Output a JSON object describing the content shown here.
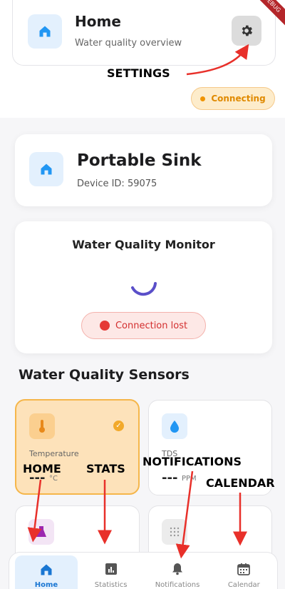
{
  "header": {
    "title": "Home",
    "subtitle": "Water quality overview",
    "debug_badge": "DEBUG"
  },
  "status": {
    "label": "Connecting"
  },
  "device": {
    "name": "Portable Sink",
    "id_text": "Device ID: 59075"
  },
  "monitor": {
    "title": "Water Quality Monitor",
    "connection_status": "Connection lost"
  },
  "sensors": {
    "section_title": "Water Quality Sensors",
    "items": [
      {
        "label": "Temperature",
        "value": "---",
        "unit": "°C",
        "icon": "thermometer-icon"
      },
      {
        "label": "TDS",
        "value": "---",
        "unit": "PPM",
        "icon": "water-drop-icon"
      },
      {
        "label": "",
        "value": "",
        "unit": "",
        "icon": "flask-icon"
      },
      {
        "label": "",
        "value": "",
        "unit": "",
        "icon": "grid-dots-icon"
      }
    ]
  },
  "nav": [
    {
      "label": "Home",
      "icon": "home-icon",
      "active": true
    },
    {
      "label": "Statistics",
      "icon": "bar-chart-icon",
      "active": false
    },
    {
      "label": "Notifications",
      "icon": "bell-icon",
      "active": false
    },
    {
      "label": "Calendar",
      "icon": "calendar-icon",
      "active": false
    }
  ],
  "annotations": {
    "settings": "SETTINGS",
    "home": "HOME",
    "stats": "STATS",
    "notifications": "NOTIFICATIONS",
    "calendar": "CALENDAR"
  },
  "colors": {
    "accent_blue": "#1976d2",
    "warning_orange": "#f09400",
    "error_red": "#e53935",
    "annotation_arrow": "#e8302a"
  }
}
